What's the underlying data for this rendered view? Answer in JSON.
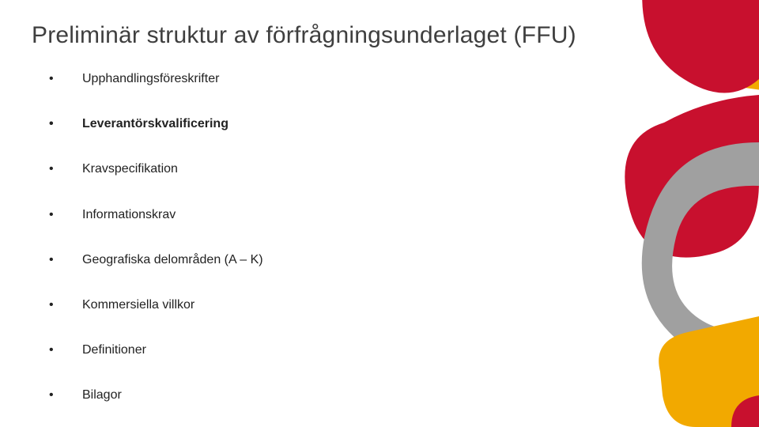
{
  "title": "Preliminär struktur av förfrågningsunderlaget (FFU)",
  "bullets": {
    "b0": "Upphandlingsföreskrifter",
    "b1": "Leverantörskvalificering",
    "b2": "Kravspecifikation",
    "b3": "Informationskrav",
    "b4": "Geografiska delområden (A – K)",
    "b5": "Kommersiella villkor",
    "b6": "Definitioner",
    "b7": "Bilagor"
  },
  "colors": {
    "crimson": "#c8102e",
    "gray": "#a0a0a0",
    "amber": "#f2a900"
  }
}
